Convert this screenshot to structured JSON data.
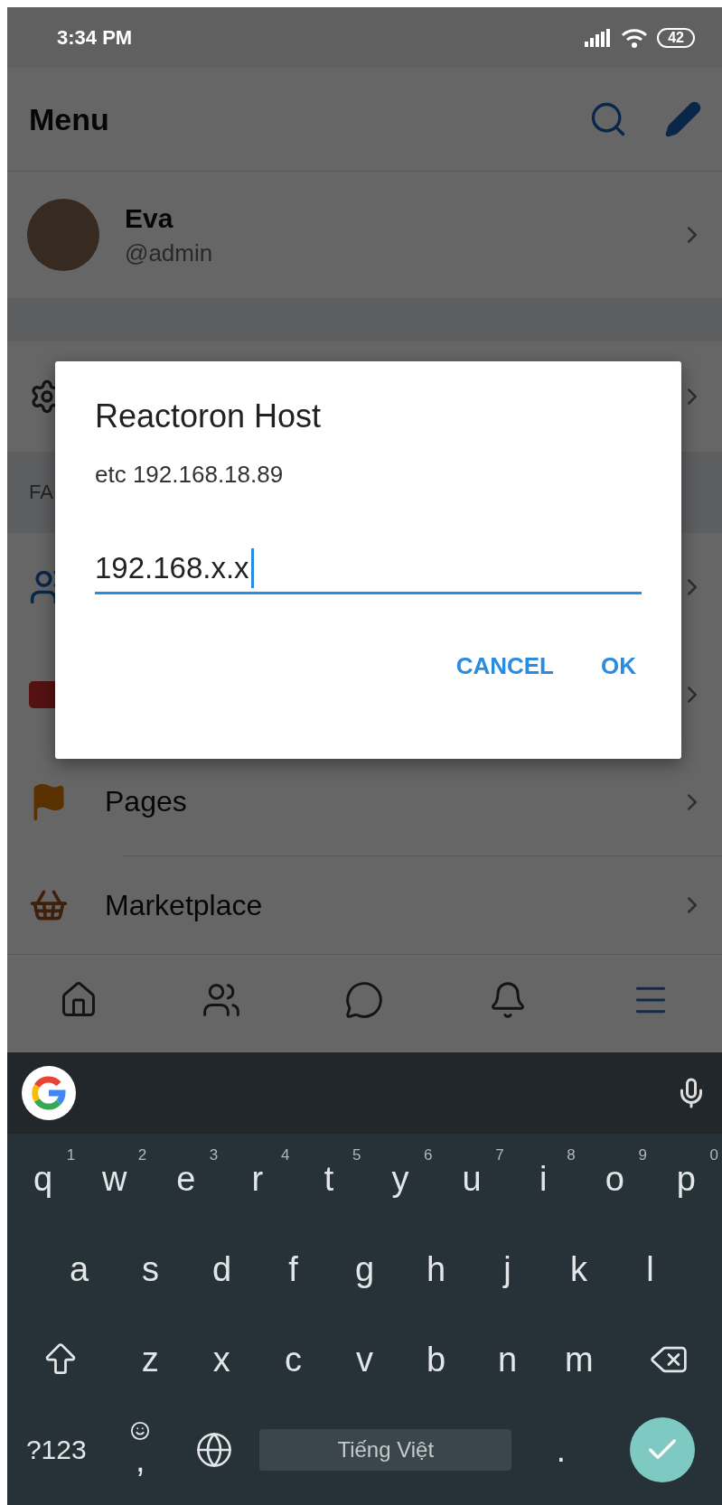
{
  "status_bar": {
    "time": "3:34 PM",
    "battery": "42"
  },
  "header": {
    "title": "Menu"
  },
  "profile": {
    "name": "Eva",
    "handle": "@admin"
  },
  "top_items": [
    {
      "kind": "settings"
    }
  ],
  "section_header": {
    "label": "FA"
  },
  "menu_items": [
    {
      "kind": "groups"
    },
    {
      "kind": "video"
    },
    {
      "kind": "pages",
      "label": "Pages"
    },
    {
      "kind": "marketplace",
      "label": "Marketplace"
    }
  ],
  "tab_bar": [
    {
      "kind": "home",
      "selected": false
    },
    {
      "kind": "friends",
      "selected": false
    },
    {
      "kind": "messages",
      "selected": false
    },
    {
      "kind": "notifications",
      "selected": false
    },
    {
      "kind": "menu",
      "selected": true
    }
  ],
  "dialog": {
    "title": "Reactoron Host",
    "message": "etc 192.168.18.89",
    "input": {
      "value": "192.168.x.x",
      "focused": true
    },
    "buttons": [
      "CANCEL",
      "OK"
    ]
  },
  "keyboard": {
    "rows": [
      {
        "keys": [
          {
            "label": "q",
            "hint": "1"
          },
          {
            "label": "w",
            "hint": "2"
          },
          {
            "label": "e",
            "hint": "3"
          },
          {
            "label": "r",
            "hint": "4"
          },
          {
            "label": "t",
            "hint": "5"
          },
          {
            "label": "y",
            "hint": "6"
          },
          {
            "label": "u",
            "hint": "7"
          },
          {
            "label": "i",
            "hint": "8"
          },
          {
            "label": "o",
            "hint": "9"
          },
          {
            "label": "p",
            "hint": "0"
          }
        ]
      },
      {
        "keys": [
          {
            "label": "a"
          },
          {
            "label": "s"
          },
          {
            "label": "d"
          },
          {
            "label": "f"
          },
          {
            "label": "g"
          },
          {
            "label": "h"
          },
          {
            "label": "j"
          },
          {
            "label": "k"
          },
          {
            "label": "l"
          }
        ]
      },
      {
        "keys": [
          {
            "kind": "shift"
          },
          {
            "label": "z"
          },
          {
            "label": "x"
          },
          {
            "label": "c"
          },
          {
            "label": "v"
          },
          {
            "label": "b"
          },
          {
            "label": "n"
          },
          {
            "label": "m"
          },
          {
            "kind": "backspace"
          }
        ]
      },
      {
        "keys": [
          {
            "kind": "symbols",
            "label": "?123"
          },
          {
            "kind": "emoji",
            "label": ","
          },
          {
            "kind": "globe"
          },
          {
            "kind": "space",
            "label": "Tiếng Việt"
          },
          {
            "label": "."
          },
          {
            "kind": "enter"
          }
        ]
      }
    ]
  }
}
